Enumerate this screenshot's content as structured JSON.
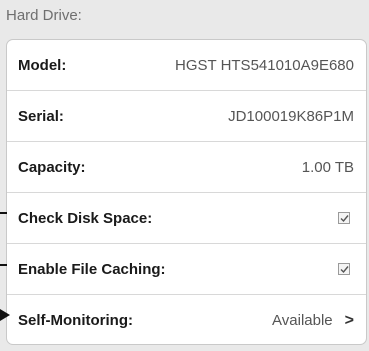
{
  "section": {
    "title": "Hard Drive:"
  },
  "rows": [
    {
      "label": "Model:",
      "value": "HGST HTS541010A9E680"
    },
    {
      "label": "Serial:",
      "value": "JD100019K86P1M"
    },
    {
      "label": "Capacity:",
      "value": "1.00 TB"
    },
    {
      "label": "Check Disk Space:",
      "checked": true
    },
    {
      "label": "Enable File Caching:",
      "checked": true
    },
    {
      "label": "Self-Monitoring:",
      "value": "Available",
      "chevron": ">"
    }
  ]
}
